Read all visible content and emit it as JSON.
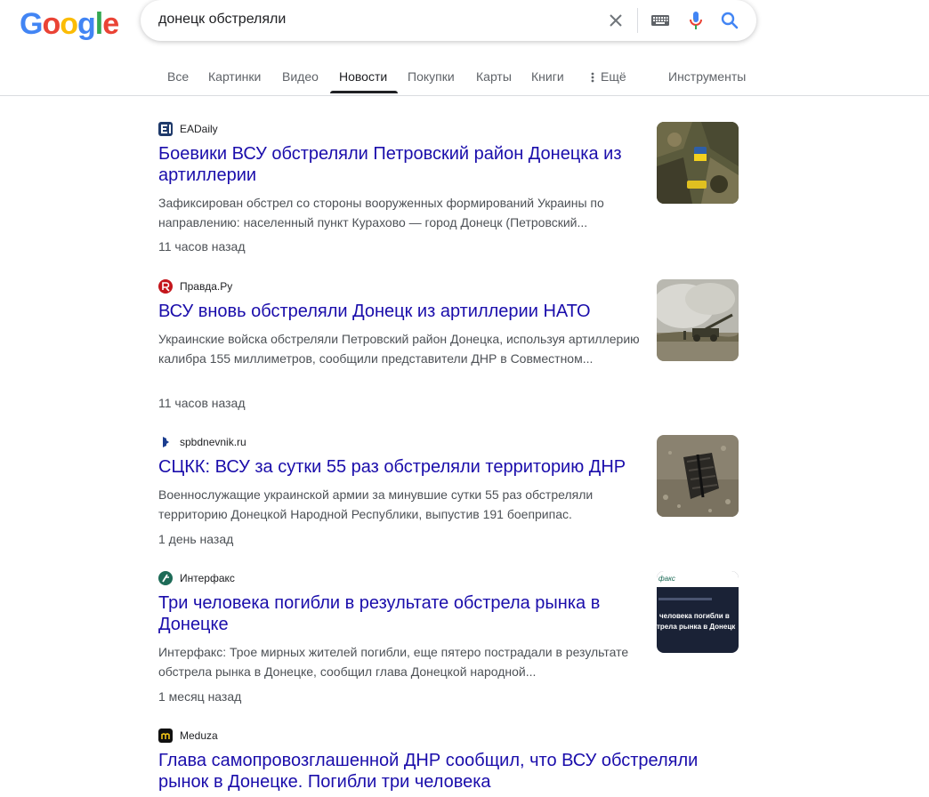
{
  "search": {
    "query": "донецк обстреляли"
  },
  "tabs": [
    {
      "label": "Все"
    },
    {
      "label": "Картинки"
    },
    {
      "label": "Видео"
    },
    {
      "label": "Новости"
    },
    {
      "label": "Покупки"
    },
    {
      "label": "Карты"
    },
    {
      "label": "Книги"
    },
    {
      "label": "Ещё"
    },
    {
      "label": "Инструменты"
    }
  ],
  "active_tab": "Новости",
  "results": [
    {
      "source": "EADaily",
      "title": "Боевики ВСУ обстреляли Петровский район Донецка из артиллерии",
      "snippet": "Зафиксирован обстрел со стороны вооруженных формирований Украины по направлению: населенный пункт Курахово — город Донецк (Петровский...",
      "time": "11 часов назад"
    },
    {
      "source": "Правда.Ру",
      "title": "ВСУ вновь обстреляли Донецк из артиллерии НАТО",
      "snippet": "Украинские войска обстреляли Петровский район Донецка, используя артиллерию калибра 155 миллиметров, сообщили представители ДНР в Совместном...",
      "time": "11 часов назад"
    },
    {
      "source": "spbdnevnik.ru",
      "title": "СЦКК: ВСУ за сутки 55 раз обстреляли территорию ДНР",
      "snippet": "Военнослужащие украинской армии за минувшие сутки 55 раз обстреляли территорию Донецкой Народной Республики, выпустив 191 боеприпас.",
      "time": "1 день назад"
    },
    {
      "source": "Интерфакс",
      "title": "Три человека погибли в результате обстрела рынка в Донецке",
      "snippet": "Интерфакс: Трое мирных жителей погибли, еще пятеро пострадали в результате обстрела рынка в Донецке, сообщил глава Донецкой народной...",
      "time": "1 месяц назад",
      "thumb_text": {
        "brand": "факс",
        "line1": "человека погибли в",
        "line2": "трела рынка в Донецк"
      }
    },
    {
      "source": "Meduza",
      "title": "Глава самопровозглашенной ДНР сообщил, что ВСУ обстреляли рынок в Донецке. Погибли три человека"
    }
  ],
  "icons": {
    "clear": "close-icon",
    "keyboard": "keyboard-icon",
    "mic": "microphone-icon",
    "search": "search-icon"
  },
  "colors": {
    "link": "#1a0dab",
    "active_tab_underline": "#202124",
    "snippet": "#4d5156"
  }
}
